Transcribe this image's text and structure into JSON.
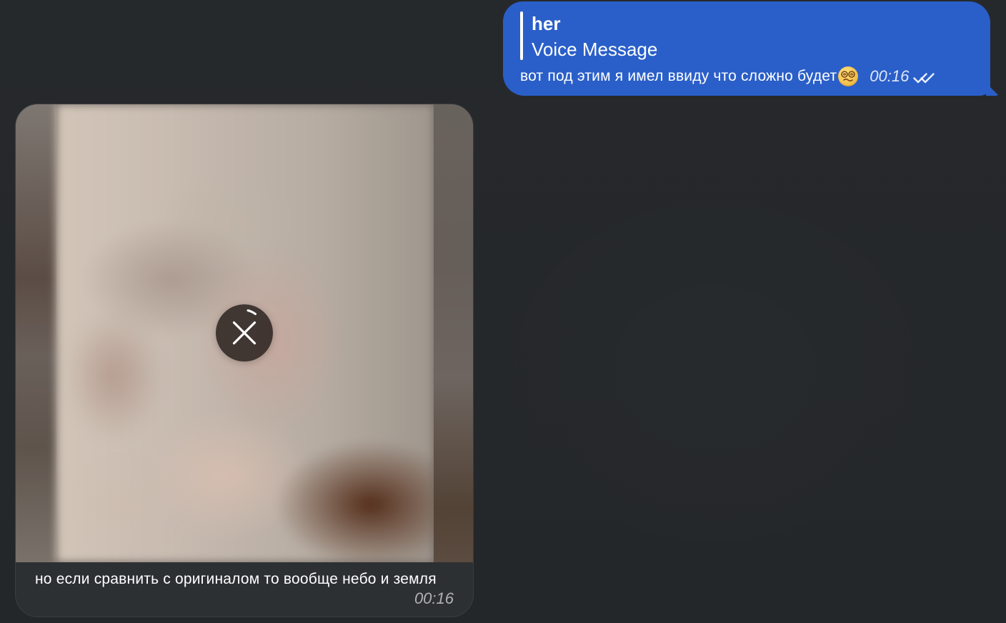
{
  "chat": {
    "outgoing_message": {
      "reply_sender": "her",
      "reply_preview": "Voice Message",
      "text": "вот под этим я имел ввиду что сложно будет",
      "emoji_icon": "woozy-face-emoji",
      "time": "00:16",
      "status_icon": "double-check-icon",
      "bubble_color": "#2a5fc9"
    },
    "incoming_message": {
      "media_status_icon": "close-icon",
      "caption": "но если сравнить с оригиналом то вообще небо и земля",
      "time": "00:16",
      "bubble_color": "#2d3033"
    }
  }
}
